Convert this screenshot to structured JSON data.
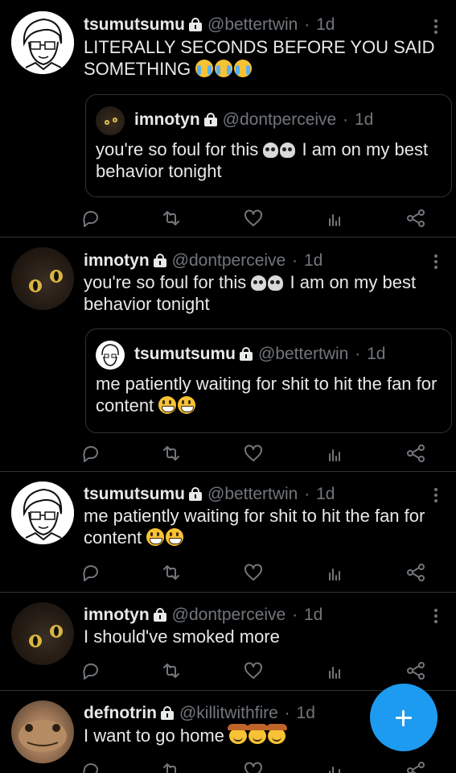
{
  "tweets": [
    {
      "name": "tsumutsumu",
      "handle": "@bettertwin",
      "time": "1d",
      "text": "LITERALLY SECONDS BEFORE YOU SAID SOMETHING",
      "quote": {
        "name": "imnotyn",
        "handle": "@dontperceive",
        "time": "1d",
        "text_before": "you're so foul for this",
        "text_after": "I am on my best behavior tonight"
      }
    },
    {
      "name": "imnotyn",
      "handle": "@dontperceive",
      "time": "1d",
      "text_before": "you're so foul for this",
      "text_after": "I am on my best behavior tonight",
      "quote": {
        "name": "tsumutsumu",
        "handle": "@bettertwin",
        "time": "1d",
        "text": "me patiently waiting for shit to hit the fan for content"
      }
    },
    {
      "name": "tsumutsumu",
      "handle": "@bettertwin",
      "time": "1d",
      "text": "me patiently waiting for shit to hit the fan for content"
    },
    {
      "name": "imnotyn",
      "handle": "@dontperceive",
      "time": "1d",
      "text": "I should've smoked more"
    },
    {
      "name": "defnotrin",
      "handle": "@killitwithfire",
      "time": "1d",
      "text": "I want to go home"
    }
  ],
  "separator": "·",
  "colors": {
    "background": "#000000",
    "text": "#e7e9ea",
    "muted": "#71767b",
    "accent": "#1d9bf0",
    "border": "#2f3336"
  },
  "icons": [
    "reply-icon",
    "retweet-icon",
    "like-icon",
    "views-icon",
    "share-icon",
    "lock-icon",
    "more-icon",
    "compose-icon"
  ]
}
